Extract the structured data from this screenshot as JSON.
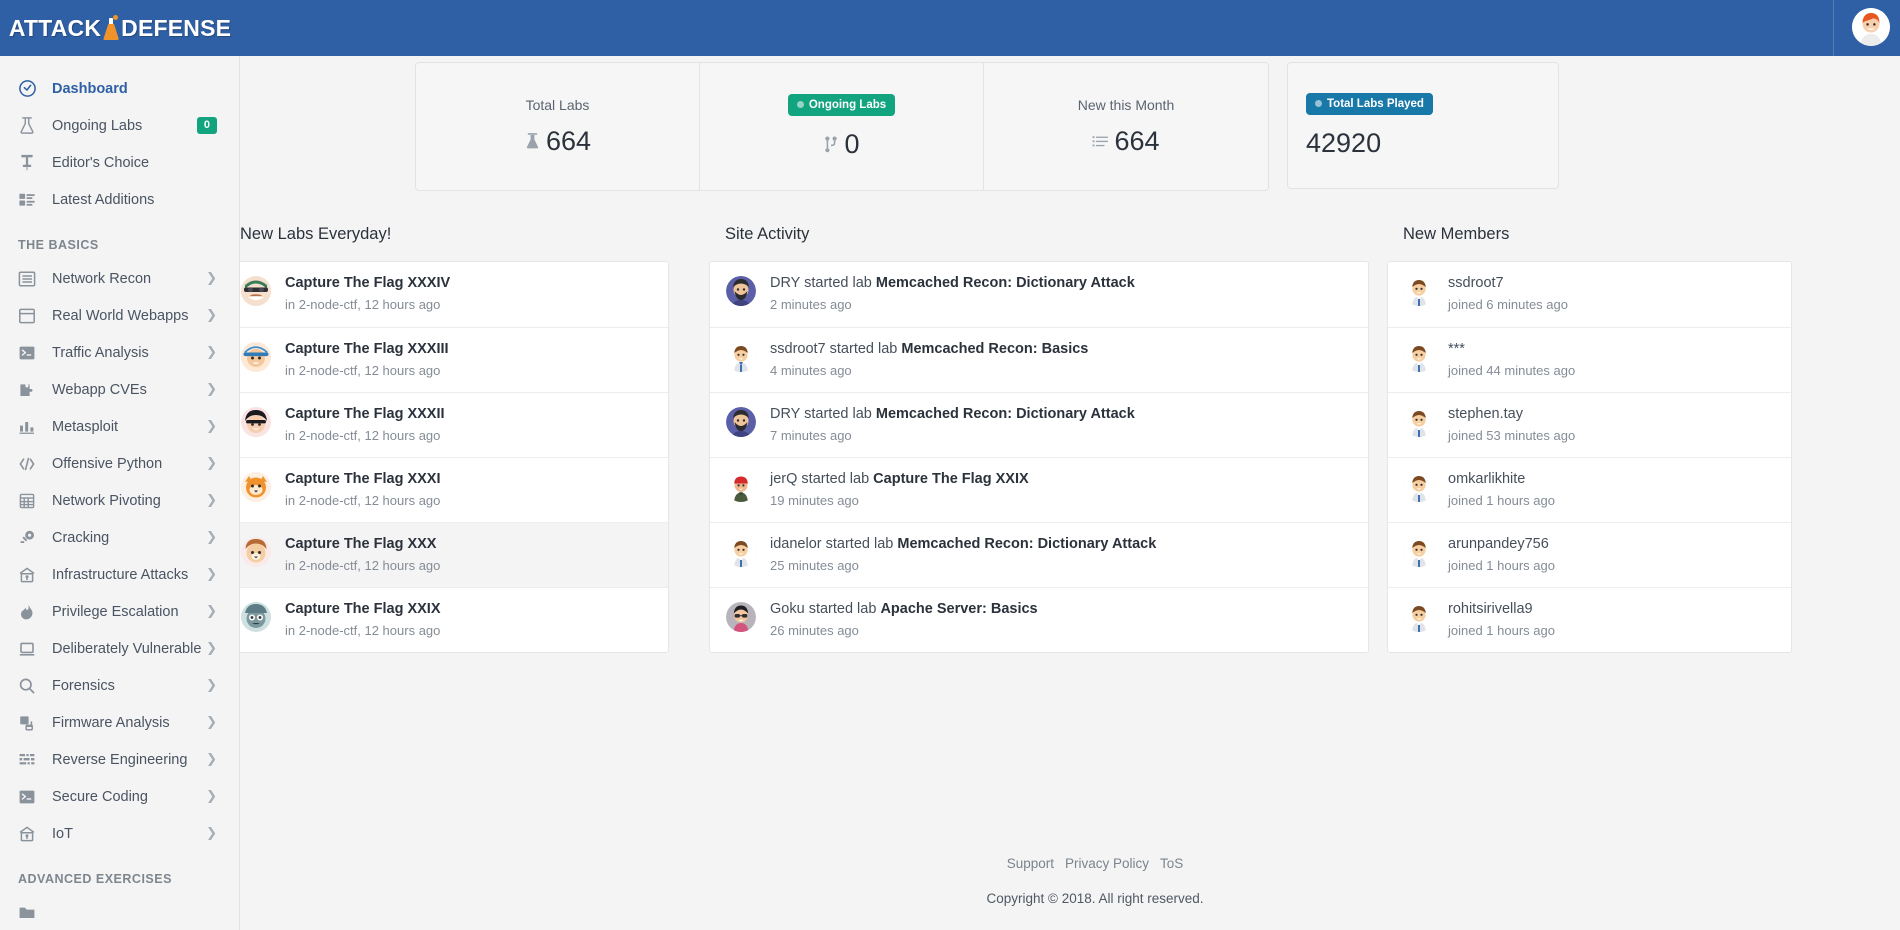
{
  "brand": {
    "part1": "ATTACK",
    "part2": "DEFENSE",
    "logo_icon": "flask-logo"
  },
  "topbar": {
    "avatar_icon": "user-avatar-icon"
  },
  "sidebar": {
    "primary": [
      {
        "label": "Dashboard",
        "icon": "dashboard-icon",
        "active": true,
        "badge": null,
        "chevron": false
      },
      {
        "label": "Ongoing Labs",
        "icon": "flask-icon",
        "active": false,
        "badge": "0",
        "chevron": false
      },
      {
        "label": "Editor's Choice",
        "icon": "pin-icon",
        "active": false,
        "badge": null,
        "chevron": false
      },
      {
        "label": "Latest Additions",
        "icon": "list-blocks-icon",
        "active": false,
        "badge": null,
        "chevron": false
      }
    ],
    "section_basics": "THE BASICS",
    "basics": [
      {
        "label": "Network Recon",
        "icon": "list-icon"
      },
      {
        "label": "Real World Webapps",
        "icon": "browser-icon"
      },
      {
        "label": "Traffic Analysis",
        "icon": "terminal-icon"
      },
      {
        "label": "Webapp CVEs",
        "icon": "puzzle-icon"
      },
      {
        "label": "Metasploit",
        "icon": "bar-chart-icon"
      },
      {
        "label": "Offensive Python",
        "icon": "code-icon"
      },
      {
        "label": "Network Pivoting",
        "icon": "grid-icon"
      },
      {
        "label": "Cracking",
        "icon": "key-icon"
      },
      {
        "label": "Infrastructure Attacks",
        "icon": "bank-icon"
      },
      {
        "label": "Privilege Escalation",
        "icon": "flame-icon"
      },
      {
        "label": "Deliberately Vulnerable",
        "icon": "monitor-icon"
      },
      {
        "label": "Forensics",
        "icon": "magnifier-icon"
      },
      {
        "label": "Firmware Analysis",
        "icon": "layers-icon"
      },
      {
        "label": "Reverse Engineering",
        "icon": "chip-icon"
      },
      {
        "label": "Secure Coding",
        "icon": "terminal-icon"
      },
      {
        "label": "IoT",
        "icon": "bank-icon"
      }
    ],
    "section_advanced": "ADVANCED EXERCISES"
  },
  "stats": {
    "cells": [
      {
        "title": "Total Labs",
        "value": "664",
        "icon": "flask-icon",
        "pill": null
      },
      {
        "title": null,
        "value": "0",
        "icon": "branch-icon",
        "pill": {
          "label": "Ongoing Labs",
          "color": "#12a37f"
        }
      },
      {
        "title": "New this Month",
        "value": "664",
        "icon": "list-icon",
        "pill": null
      }
    ],
    "solo": {
      "value": "42920",
      "pill": {
        "label": "Total Labs Played",
        "color": "#1878a8"
      }
    }
  },
  "panels": {
    "labs": {
      "title": "New Labs Everyday!",
      "rows": [
        {
          "title": "Capture The Flag XXXIV",
          "sub": "in 2-node-ctf, 12 hours ago",
          "highlight": false,
          "avatar": "#f0a070"
        },
        {
          "title": "Capture The Flag XXXIII",
          "sub": "in 2-node-ctf, 12 hours ago",
          "highlight": false,
          "avatar": "#4f93d8"
        },
        {
          "title": "Capture The Flag XXXII",
          "sub": "in 2-node-ctf, 12 hours ago",
          "highlight": false,
          "avatar": "#2f2f33"
        },
        {
          "title": "Capture The Flag XXXI",
          "sub": "in 2-node-ctf, 12 hours ago",
          "highlight": false,
          "avatar": "#f2953c"
        },
        {
          "title": "Capture The Flag XXX",
          "sub": "in 2-node-ctf, 12 hours ago",
          "highlight": true,
          "avatar": "#e38c4c"
        },
        {
          "title": "Capture The Flag XXIX",
          "sub": "in 2-node-ctf, 12 hours ago",
          "highlight": false,
          "avatar": "#5f9ea0"
        }
      ]
    },
    "activity": {
      "title": "Site Activity",
      "rows": [
        {
          "user": "DRY",
          "action": " started lab ",
          "lab": "Memcached Recon: Dictionary Attack",
          "sub": "2 minutes ago",
          "avatar": "#5b5fa8"
        },
        {
          "user": "ssdroot7",
          "action": " started lab ",
          "lab": "Memcached Recon: Basics",
          "sub": "4 minutes ago",
          "avatar": "#d9a07a"
        },
        {
          "user": "DRY",
          "action": " started lab ",
          "lab": "Memcached Recon: Dictionary Attack",
          "sub": "7 minutes ago",
          "avatar": "#5b5fa8"
        },
        {
          "user": "jerQ",
          "action": " started lab ",
          "lab": "Capture The Flag XXIX",
          "sub": "19 minutes ago",
          "avatar": "#cf3c3c"
        },
        {
          "user": "idanelor",
          "action": " started lab ",
          "lab": "Memcached Recon: Dictionary Attack",
          "sub": "25 minutes ago",
          "avatar": "#d9a07a"
        },
        {
          "user": "Goku",
          "action": " started lab ",
          "lab": "Apache Server: Basics",
          "sub": "26 minutes ago",
          "avatar": "#9b9b9b"
        }
      ]
    },
    "members": {
      "title": "New Members",
      "rows": [
        {
          "name": "ssdroot7",
          "sub": "joined 6 minutes ago",
          "avatar": "#d9a07a"
        },
        {
          "name": "***",
          "sub": "joined 44 minutes ago",
          "avatar": "#d9a07a"
        },
        {
          "name": "stephen.tay",
          "sub": "joined 53 minutes ago",
          "avatar": "#d9a07a"
        },
        {
          "name": "omkarlikhite",
          "sub": "joined 1 hours ago",
          "avatar": "#d9a07a"
        },
        {
          "name": "arunpandey756",
          "sub": "joined 1 hours ago",
          "avatar": "#d9a07a"
        },
        {
          "name": "rohitsirivella9",
          "sub": "joined 1 hours ago",
          "avatar": "#d9a07a"
        }
      ]
    }
  },
  "footer": {
    "links": [
      "Support",
      "Privacy Policy",
      "ToS"
    ],
    "copyright": "Copyright © 2018. All right reserved."
  },
  "colors": {
    "header_blue": "#2f60a5",
    "accent_green": "#12a37f",
    "accent_blue": "#1878a8",
    "page_bg": "#f4f4f4"
  }
}
